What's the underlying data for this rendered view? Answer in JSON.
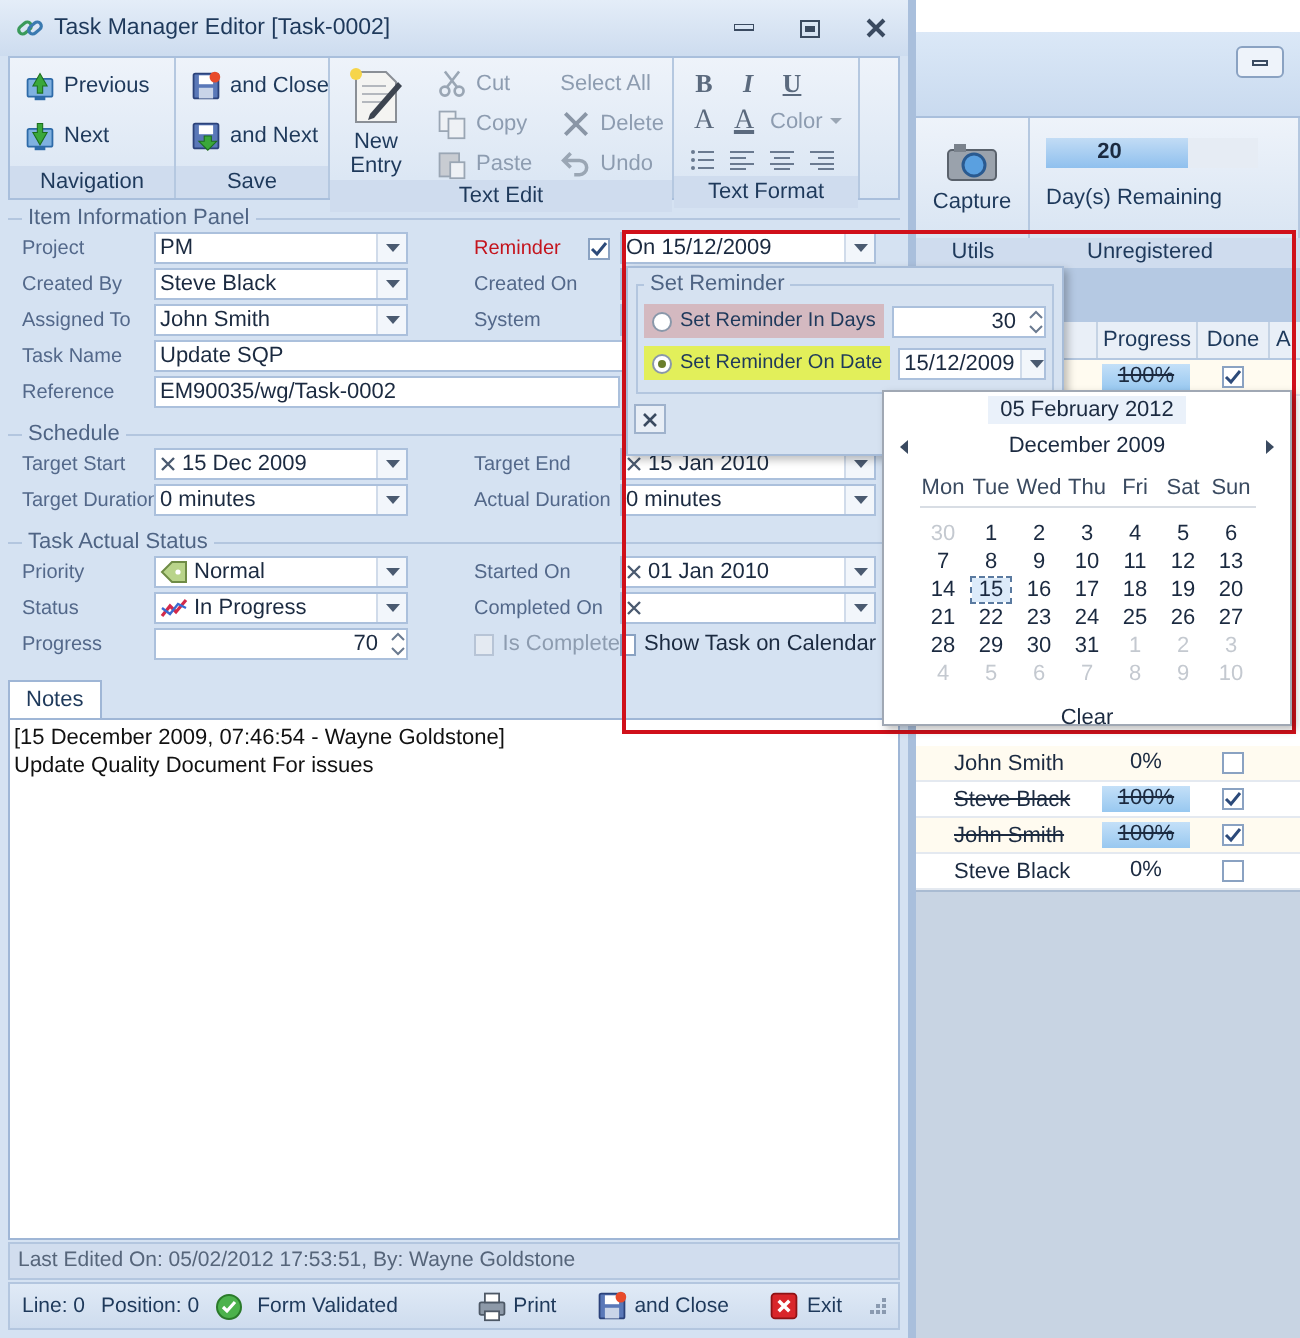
{
  "window": {
    "title": "Task Manager Editor [Task-0002]"
  },
  "ribbon": {
    "navigation": {
      "label": "Navigation",
      "buttons": [
        {
          "kind": "previous",
          "label": "Previous"
        },
        {
          "kind": "next",
          "label": "Next"
        }
      ]
    },
    "save": {
      "label": "Save",
      "buttons": [
        {
          "kind": "save_close",
          "label": "and Close"
        },
        {
          "kind": "save_next",
          "label": "and Next"
        }
      ]
    },
    "text_edit": {
      "label": "Text Edit",
      "new_entry": {
        "label": "New Entry"
      },
      "columns": [
        [
          {
            "kind": "cut",
            "label": "Cut",
            "disabled": true
          },
          {
            "kind": "copy",
            "label": "Copy",
            "disabled": true
          },
          {
            "kind": "paste",
            "label": "Paste",
            "disabled": true
          }
        ],
        [
          {
            "kind": "select_all",
            "label": "Select All",
            "disabled": true
          },
          {
            "kind": "delete",
            "label": "Delete",
            "disabled": true
          },
          {
            "kind": "undo",
            "label": "Undo",
            "disabled": true
          }
        ]
      ]
    },
    "text_format": {
      "label": "Text Format",
      "styles": [
        "B",
        "I",
        "U"
      ],
      "font_color": [
        "A",
        "A"
      ],
      "color": {
        "label": "Color",
        "disabled": true
      }
    }
  },
  "item_information": {
    "legend": "Item Information Panel",
    "project": {
      "label": "Project",
      "value": "PM"
    },
    "created_by": {
      "label": "Created By",
      "value": "Steve Black"
    },
    "assigned_to": {
      "label": "Assigned To",
      "value": "John Smith"
    },
    "task_name": {
      "label": "Task Name",
      "value": "Update SQP"
    },
    "reference": {
      "label": "Reference",
      "value": "EM90035/wg/Task-0002"
    },
    "reminder": {
      "label": "Reminder",
      "checked": true,
      "value": "On 15/12/2009"
    },
    "created_on": {
      "label": "Created On"
    },
    "system": {
      "label": "System"
    }
  },
  "schedule": {
    "legend": "Schedule",
    "target_start": {
      "label": "Target Start",
      "value": "15 Dec 2009"
    },
    "target_duration": {
      "label": "Target Duration",
      "value": "0 minutes"
    },
    "target_end": {
      "label": "Target End",
      "value": "15 Jan 2010"
    },
    "actual_duration": {
      "label": "Actual Duration",
      "value": "0 minutes"
    }
  },
  "actual_status": {
    "legend": "Task Actual Status",
    "priority": {
      "label": "Priority",
      "value": "Normal"
    },
    "status": {
      "label": "Status",
      "value": "In Progress"
    },
    "progress": {
      "label": "Progress",
      "value": "70"
    },
    "started_on": {
      "label": "Started On",
      "value": "01 Jan 2010"
    },
    "completed_on": {
      "label": "Completed On"
    },
    "is_complete": {
      "label": "Is Complete",
      "checked": false,
      "disabled": true
    },
    "show_on_calendar": {
      "label": "Show Task on Calendar",
      "checked": false,
      "disabled": false
    }
  },
  "notes": {
    "tab": {
      "label": "Notes",
      "selected": true
    },
    "lines": [
      "[15 December 2009, 07:46:54 - Wayne Goldstone]",
      "Update Quality Document For issues"
    ]
  },
  "last_edited": "Last Edited On: 05/02/2012 17:53:51, By: Wayne Goldstone",
  "status_bar": {
    "line": "Line: 0",
    "position": "Position: 0",
    "validation": "Form Validated",
    "buttons": [
      {
        "kind": "print",
        "label": "Print"
      },
      {
        "kind": "save_close",
        "label": "and Close"
      },
      {
        "kind": "exit",
        "label": "Exit"
      }
    ]
  },
  "reminder_popup": {
    "legend": "Set Reminder",
    "options": [
      {
        "kind": "days",
        "label": "Set Reminder In Days",
        "selected": false,
        "value": "30"
      },
      {
        "kind": "date",
        "label": "Set Reminder On Date",
        "selected": true,
        "value": "15/12/2009"
      }
    ]
  },
  "calendar": {
    "today": "05 February 2012",
    "month": "December 2009",
    "weekdays": [
      "Mon",
      "Tue",
      "Wed",
      "Thu",
      "Fri",
      "Sat",
      "Sun"
    ],
    "clear": "Clear",
    "days": [
      {
        "label": "30",
        "other_month": true,
        "selected": false
      },
      {
        "label": "1",
        "other_month": false,
        "selected": false
      },
      {
        "label": "2",
        "other_month": false,
        "selected": false
      },
      {
        "label": "3",
        "other_month": false,
        "selected": false
      },
      {
        "label": "4",
        "other_month": false,
        "selected": false
      },
      {
        "label": "5",
        "other_month": false,
        "selected": false
      },
      {
        "label": "6",
        "other_month": false,
        "selected": false
      },
      {
        "label": "7",
        "other_month": false,
        "selected": false
      },
      {
        "label": "8",
        "other_month": false,
        "selected": false
      },
      {
        "label": "9",
        "other_month": false,
        "selected": false
      },
      {
        "label": "10",
        "other_month": false,
        "selected": false
      },
      {
        "label": "11",
        "other_month": false,
        "selected": false
      },
      {
        "label": "12",
        "other_month": false,
        "selected": false
      },
      {
        "label": "13",
        "other_month": false,
        "selected": false
      },
      {
        "label": "14",
        "other_month": false,
        "selected": false
      },
      {
        "label": "15",
        "other_month": false,
        "selected": true
      },
      {
        "label": "16",
        "other_month": false,
        "selected": false
      },
      {
        "label": "17",
        "other_month": false,
        "selected": false
      },
      {
        "label": "18",
        "other_month": false,
        "selected": false
      },
      {
        "label": "19",
        "other_month": false,
        "selected": false
      },
      {
        "label": "20",
        "other_month": false,
        "selected": false
      },
      {
        "label": "21",
        "other_month": false,
        "selected": false
      },
      {
        "label": "22",
        "other_month": false,
        "selected": false
      },
      {
        "label": "23",
        "other_month": false,
        "selected": false
      },
      {
        "label": "24",
        "other_month": false,
        "selected": false
      },
      {
        "label": "25",
        "other_month": false,
        "selected": false
      },
      {
        "label": "26",
        "other_month": false,
        "selected": false
      },
      {
        "label": "27",
        "other_month": false,
        "selected": false
      },
      {
        "label": "28",
        "other_month": false,
        "selected": false
      },
      {
        "label": "29",
        "other_month": false,
        "selected": false
      },
      {
        "label": "30",
        "other_month": false,
        "selected": false
      },
      {
        "label": "31",
        "other_month": false,
        "selected": false
      },
      {
        "label": "1",
        "other_month": true,
        "selected": false
      },
      {
        "label": "2",
        "other_month": true,
        "selected": false
      },
      {
        "label": "3",
        "other_month": true,
        "selected": false
      },
      {
        "label": "4",
        "other_month": true,
        "selected": false
      },
      {
        "label": "5",
        "other_month": true,
        "selected": false
      },
      {
        "label": "6",
        "other_month": true,
        "selected": false
      },
      {
        "label": "7",
        "other_month": true,
        "selected": false
      },
      {
        "label": "8",
        "other_month": true,
        "selected": false
      },
      {
        "label": "9",
        "other_month": true,
        "selected": false
      },
      {
        "label": "10",
        "other_month": true,
        "selected": false
      }
    ]
  },
  "background_window": {
    "capture": {
      "label": "Capture"
    },
    "days_remaining": {
      "value": "20",
      "level": 0.67,
      "label": "Day(s) Remaining"
    },
    "group_labels": [
      "Utils",
      "Unregistered"
    ],
    "grid": {
      "columns": [
        {
          "label": "Progress"
        },
        {
          "label": "Done"
        },
        {
          "label": "A"
        }
      ],
      "rows": [
        {
          "progress": "100%",
          "done": true,
          "completed": true
        },
        {
          "name": "John Smith",
          "progress": "0%",
          "done": false,
          "completed": false
        },
        {
          "name": "Steve Black",
          "progress": "100%",
          "done": true,
          "completed": true
        },
        {
          "name": "John Smith",
          "progress": "100%",
          "done": true,
          "completed": true
        },
        {
          "name": "Steve Black",
          "progress": "0%",
          "done": false,
          "completed": false
        }
      ]
    }
  }
}
